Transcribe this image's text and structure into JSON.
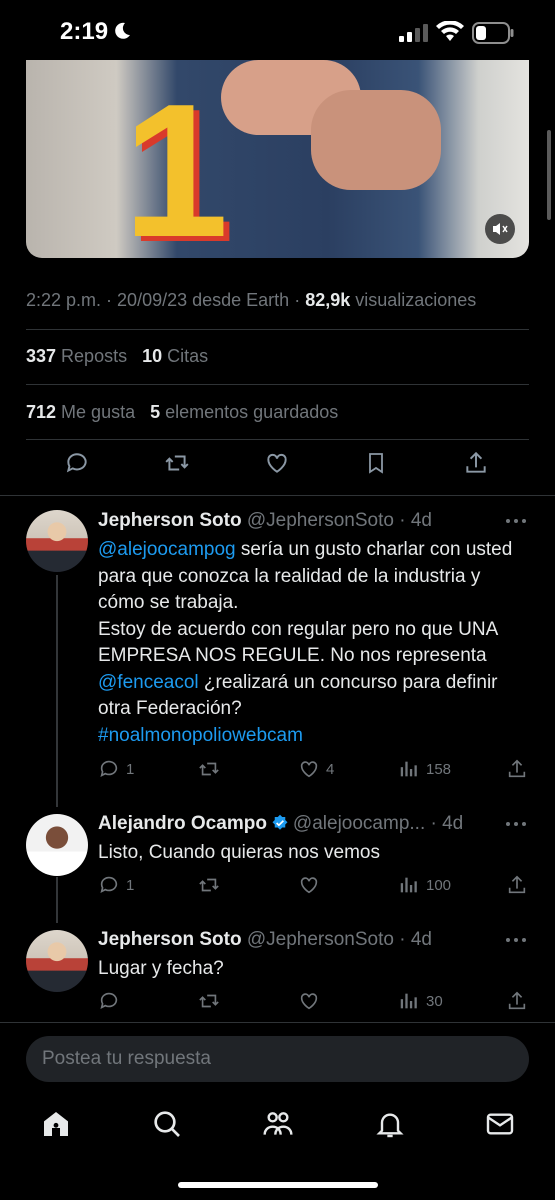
{
  "status_bar": {
    "time": "2:19"
  },
  "media": {
    "overlay_digit": "1",
    "mute_icon": "speaker-muted-icon"
  },
  "meta": {
    "time": "2:22 p.m.",
    "sep1": " · ",
    "date": "20/09/23",
    "source": " desde Earth",
    "sep2": " · ",
    "views_count": "82,9k",
    "views_label": " visualizaciones"
  },
  "stats": {
    "reposts_count": "337",
    "reposts_label": " Reposts",
    "quotes_count": "10",
    "quotes_label": " Citas",
    "likes_count": "712",
    "likes_label": " Me gusta",
    "bookmarks_count": "5",
    "bookmarks_label": " elementos guardados"
  },
  "actions": [
    "reply-icon",
    "repost-icon",
    "like-icon",
    "bookmark-icon",
    "share-icon"
  ],
  "replies": [
    {
      "name": "Jepherson Soto",
      "handle": "@JephersonSoto",
      "time": "· 4d",
      "text": {
        "mention1": "@alejoocampog",
        "part1": " sería un gusto charlar con usted para que conozca la realidad de la industria y cómo se trabaja.",
        "part2": "Estoy  de acuerdo con regular pero no que UNA EMPRESA NOS REGULE. No nos representa ",
        "mention2": "@fenceacol",
        "part3": " ¿realizará un concurso para definir otra Federación?",
        "hashtag": "#noalmonopoliowebcam"
      },
      "replies": "1",
      "reposts": "",
      "likes": "4",
      "views": "158"
    },
    {
      "name": "Alejandro Ocampo",
      "handle": "@alejoocamp...",
      "time": "· 4d",
      "text": "Listo, Cuando quieras nos vemos",
      "replies": "1",
      "reposts": "",
      "likes": "",
      "views": "100"
    },
    {
      "name": "Jepherson Soto",
      "handle": "@JephersonSoto",
      "time": "· 4d",
      "text": "Lugar y fecha?",
      "replies": "",
      "reposts": "",
      "likes": "",
      "views": "30"
    }
  ],
  "compose": {
    "placeholder": "Postea tu respuesta"
  },
  "tabbar": [
    "home-icon",
    "search-icon",
    "communities-icon",
    "notifications-icon",
    "messages-icon"
  ],
  "colors": {
    "link": "#1d9bf0",
    "muted": "#71767b",
    "background": "#000000",
    "verified": "#1d9bf0"
  }
}
